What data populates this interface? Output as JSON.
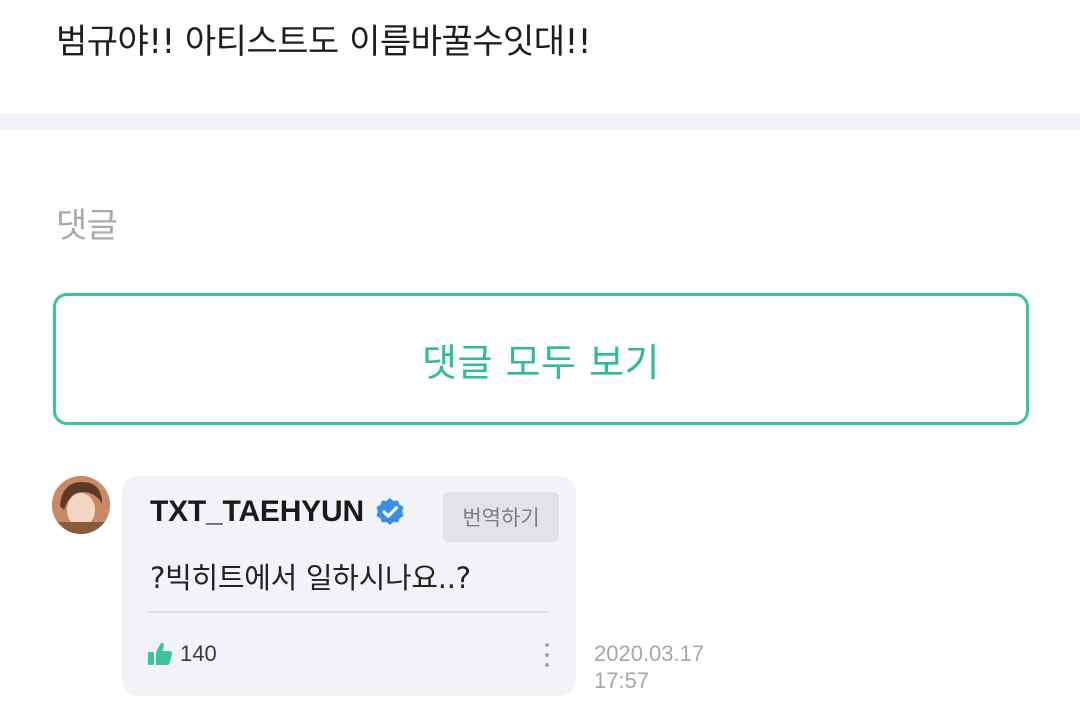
{
  "post": {
    "text": "범규야!! 아티스트도 이름바꿀수잇대!!"
  },
  "comments_section": {
    "heading": "댓글",
    "view_all_label": "댓글 모두 보기"
  },
  "comment": {
    "author": "TXT_TAEHYUN",
    "verified_icon": "verified-check-icon",
    "translate_label": "번역하기",
    "text": "?빅히트에서 일하시나요..?",
    "like_icon": "thumbs-up-icon",
    "like_count": "140",
    "more_icon": "vertical-ellipsis-icon",
    "date": "2020.03.17",
    "time": "17:57"
  },
  "colors": {
    "accent": "#2dbb99",
    "verified": "#3a8ee6",
    "like": "#3bc3a2",
    "bubble_bg": "#f2f3f7"
  }
}
